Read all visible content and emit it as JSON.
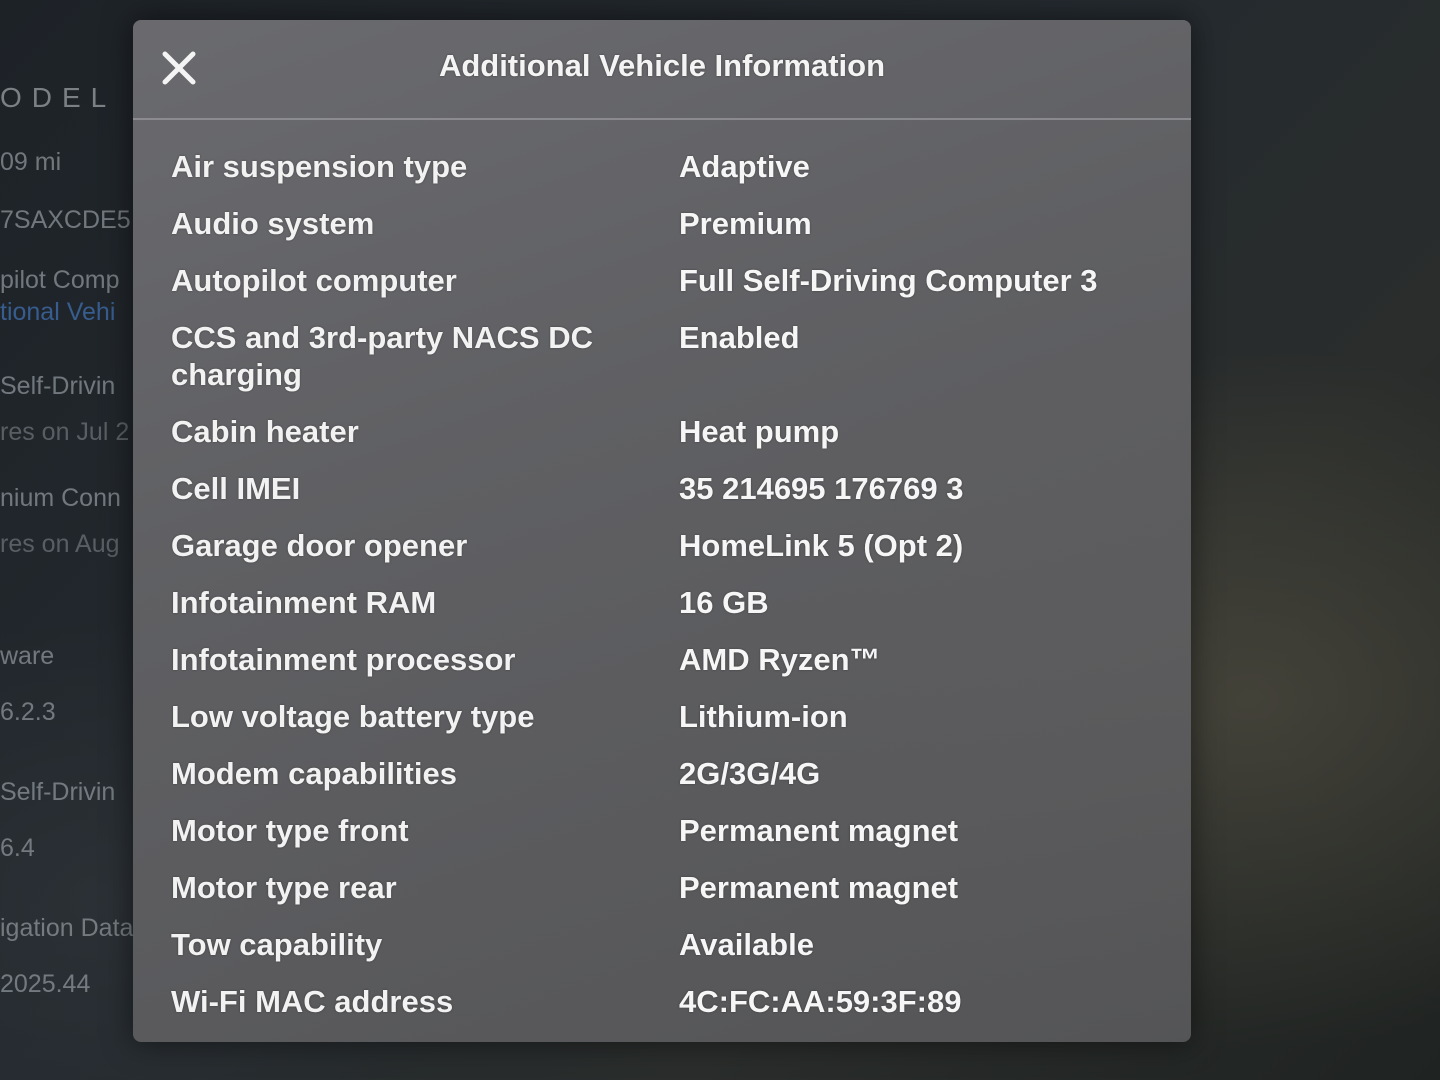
{
  "background": {
    "lines": [
      {
        "text": "ODEL",
        "kind": "logo"
      },
      {
        "text": "09 mi",
        "kind": "plain"
      },
      {
        "text": "7SAXCDE5",
        "kind": "plain"
      },
      {
        "text": "pilot Comp",
        "kind": "plain"
      },
      {
        "text": "tional Vehi",
        "kind": "link"
      },
      {
        "text": "Self-Drivin",
        "kind": "plain"
      },
      {
        "text": "res on Jul 2",
        "kind": "muted"
      },
      {
        "text": "nium Conn",
        "kind": "plain"
      },
      {
        "text": "res on Aug",
        "kind": "muted"
      },
      {
        "text": "ware",
        "kind": "plain"
      },
      {
        "text": "6.2.3",
        "kind": "plain"
      },
      {
        "text": "Self-Drivin",
        "kind": "plain"
      },
      {
        "text": "6.4",
        "kind": "plain"
      },
      {
        "text": "igation Data",
        "kind": "plain"
      },
      {
        "text": "2025.44",
        "kind": "plain"
      }
    ]
  },
  "modal": {
    "title": "Additional Vehicle Information",
    "close_icon": "close-x-icon",
    "rows": [
      {
        "label": "Air suspension type",
        "value": "Adaptive"
      },
      {
        "label": "Audio system",
        "value": "Premium"
      },
      {
        "label": "Autopilot computer",
        "value": "Full Self-Driving Computer 3"
      },
      {
        "label": "CCS and 3rd-party NACS DC charging",
        "value": "Enabled"
      },
      {
        "label": "Cabin heater",
        "value": "Heat pump"
      },
      {
        "label": "Cell IMEI",
        "value": "35 214695 176769 3"
      },
      {
        "label": "Garage door opener",
        "value": "HomeLink 5 (Opt 2)"
      },
      {
        "label": "Infotainment RAM",
        "value": "16 GB"
      },
      {
        "label": "Infotainment processor",
        "value": "AMD Ryzen™"
      },
      {
        "label": "Low voltage battery type",
        "value": "Lithium-ion"
      },
      {
        "label": "Modem capabilities",
        "value": "2G/3G/4G"
      },
      {
        "label": "Motor type front",
        "value": "Permanent magnet"
      },
      {
        "label": "Motor type rear",
        "value": "Permanent magnet"
      },
      {
        "label": "Tow capability",
        "value": "Available"
      },
      {
        "label": "Wi-Fi MAC address",
        "value": "4C:FC:AA:59:3F:89"
      }
    ]
  }
}
